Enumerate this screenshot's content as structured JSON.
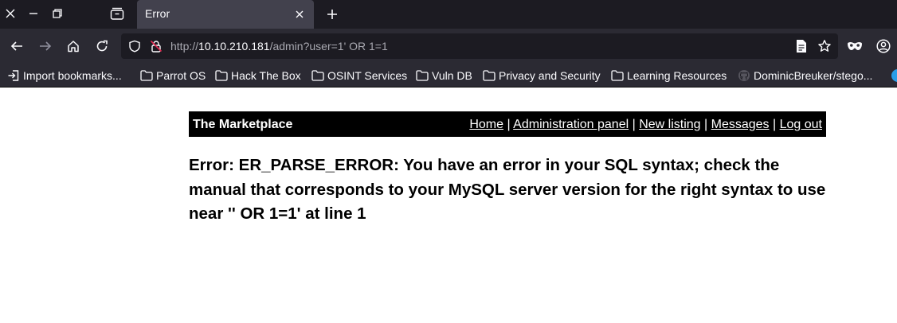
{
  "browser": {
    "tab": {
      "title": "Error"
    },
    "url": {
      "host": "http://10.10.210.181",
      "path": "/admin?user=1' OR 1=1"
    },
    "bookmarks": [
      {
        "label": "Import bookmarks...",
        "icon": "import-icon"
      },
      {
        "label": "Parrot OS",
        "icon": "folder-icon"
      },
      {
        "label": "Hack The Box",
        "icon": "folder-icon"
      },
      {
        "label": "OSINT Services",
        "icon": "folder-icon"
      },
      {
        "label": "Vuln DB",
        "icon": "folder-icon"
      },
      {
        "label": "Privacy and Security",
        "icon": "folder-icon"
      },
      {
        "label": "Learning Resources",
        "icon": "folder-icon"
      },
      {
        "label": "DominicBreuker/stego...",
        "icon": "github-icon"
      }
    ],
    "colors": {
      "chrome_dark": "#1c1b22",
      "chrome": "#2b2a33",
      "active_tab": "#42414d",
      "text": "#fbfbfe"
    }
  },
  "page": {
    "site_title": "The Marketplace",
    "nav": [
      {
        "label": "Home"
      },
      {
        "label": "Administration panel"
      },
      {
        "label": "New listing"
      },
      {
        "label": "Messages"
      },
      {
        "label": "Log out"
      }
    ],
    "separator": "|",
    "error_message": "Error: ER_PARSE_ERROR: You have an error in your SQL syntax; check the manual that corresponds to your MySQL server version for the right syntax to use near '' OR 1=1' at line 1"
  }
}
